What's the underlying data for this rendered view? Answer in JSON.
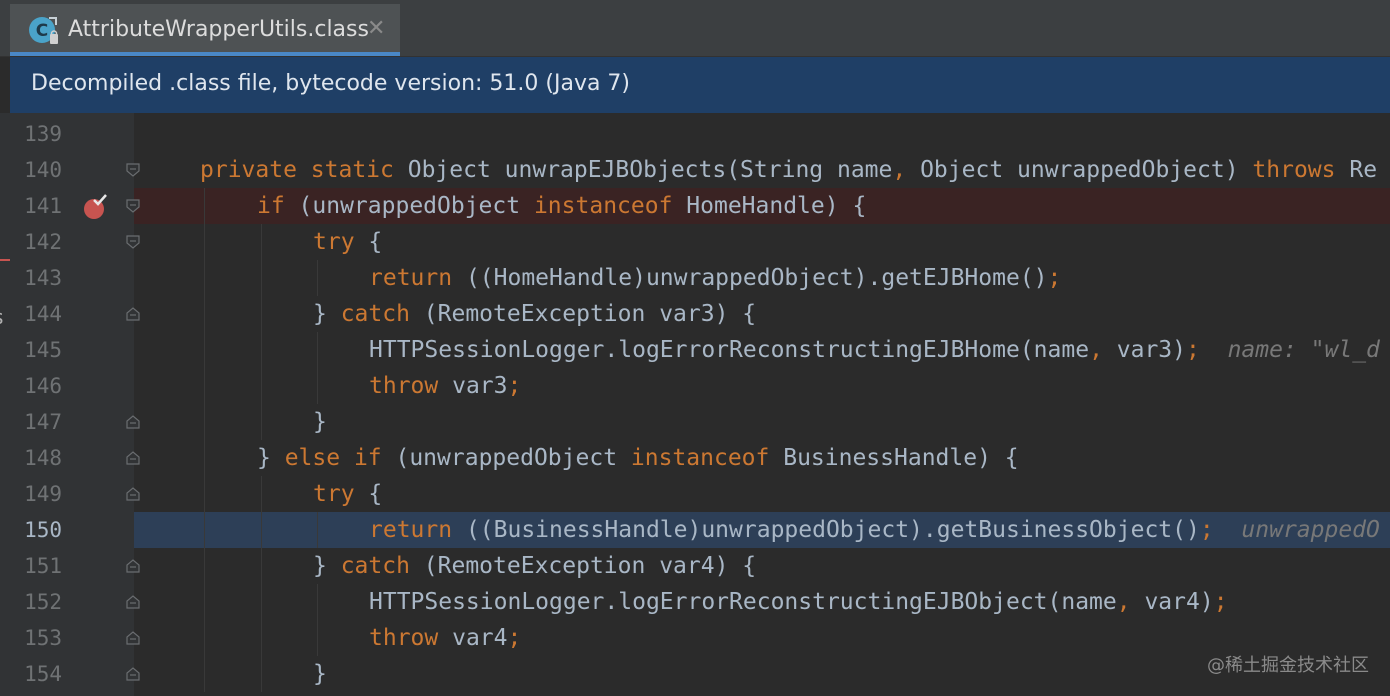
{
  "tab": {
    "title": "AttributeWrapperUtils.class",
    "close_glyph": "✕",
    "icon": "class-file-icon"
  },
  "banner": {
    "text": "Decompiled .class file, bytecode version: 51.0 (Java 7)"
  },
  "left_strip_letter": "s",
  "lines": [
    {
      "num": "139",
      "indent": 0,
      "tokens": []
    },
    {
      "num": "140",
      "indent": 1,
      "tokens": [
        {
          "t": "private ",
          "c": "kw"
        },
        {
          "t": "static ",
          "c": "kw"
        },
        {
          "t": "Object unwrapEJBObjects(String name",
          "c": ""
        },
        {
          "t": ", ",
          "c": "kw"
        },
        {
          "t": "Object unwrappedObject) ",
          "c": ""
        },
        {
          "t": "throws ",
          "c": "kw"
        },
        {
          "t": "Re",
          "c": ""
        }
      ]
    },
    {
      "num": "141",
      "indent": 2,
      "tokens": [
        {
          "t": "if ",
          "c": "kw"
        },
        {
          "t": "(unwrappedObject ",
          "c": ""
        },
        {
          "t": "instanceof ",
          "c": "kw"
        },
        {
          "t": "HomeHandle) {",
          "c": ""
        }
      ]
    },
    {
      "num": "142",
      "indent": 3,
      "tokens": [
        {
          "t": "try ",
          "c": "kw"
        },
        {
          "t": "{",
          "c": ""
        }
      ]
    },
    {
      "num": "143",
      "indent": 4,
      "tokens": [
        {
          "t": "return ",
          "c": "kw"
        },
        {
          "t": "((HomeHandle)unwrappedObject).getEJBHome()",
          "c": ""
        },
        {
          "t": ";",
          "c": "kw"
        }
      ]
    },
    {
      "num": "144",
      "indent": 3,
      "tokens": [
        {
          "t": "} ",
          "c": ""
        },
        {
          "t": "catch ",
          "c": "kw"
        },
        {
          "t": "(RemoteException var3) {",
          "c": ""
        }
      ]
    },
    {
      "num": "145",
      "indent": 4,
      "tokens": [
        {
          "t": "HTTPSessionLogger.logErrorReconstructingEJBHome(name",
          "c": ""
        },
        {
          "t": ", ",
          "c": "kw"
        },
        {
          "t": "var3)",
          "c": ""
        },
        {
          "t": ";",
          "c": "kw"
        },
        {
          "t": "  name: ",
          "c": "hint"
        },
        {
          "t": "\"wl_d",
          "c": "hint-str"
        }
      ]
    },
    {
      "num": "146",
      "indent": 4,
      "tokens": [
        {
          "t": "throw ",
          "c": "kw"
        },
        {
          "t": "var3",
          "c": ""
        },
        {
          "t": ";",
          "c": "kw"
        }
      ]
    },
    {
      "num": "147",
      "indent": 3,
      "tokens": [
        {
          "t": "}",
          "c": ""
        }
      ]
    },
    {
      "num": "148",
      "indent": 2,
      "tokens": [
        {
          "t": "} ",
          "c": ""
        },
        {
          "t": "else if ",
          "c": "kw"
        },
        {
          "t": "(unwrappedObject ",
          "c": ""
        },
        {
          "t": "instanceof ",
          "c": "kw"
        },
        {
          "t": "BusinessHandle) {",
          "c": ""
        }
      ]
    },
    {
      "num": "149",
      "indent": 3,
      "tokens": [
        {
          "t": "try ",
          "c": "kw"
        },
        {
          "t": "{",
          "c": ""
        }
      ]
    },
    {
      "num": "150",
      "indent": 4,
      "tokens": [
        {
          "t": "return ",
          "c": "kw"
        },
        {
          "t": "((BusinessHandle)unwrappedObject).getBusinessObject()",
          "c": ""
        },
        {
          "t": ";",
          "c": "kw"
        },
        {
          "t": "  unwrappedO",
          "c": "hint"
        }
      ]
    },
    {
      "num": "151",
      "indent": 3,
      "tokens": [
        {
          "t": "} ",
          "c": ""
        },
        {
          "t": "catch ",
          "c": "kw"
        },
        {
          "t": "(RemoteException var4) {",
          "c": ""
        }
      ]
    },
    {
      "num": "152",
      "indent": 4,
      "tokens": [
        {
          "t": "HTTPSessionLogger.logErrorReconstructingEJBObject(name",
          "c": ""
        },
        {
          "t": ", ",
          "c": "kw"
        },
        {
          "t": "var4)",
          "c": ""
        },
        {
          "t": ";",
          "c": "kw"
        }
      ]
    },
    {
      "num": "153",
      "indent": 4,
      "tokens": [
        {
          "t": "throw ",
          "c": "kw"
        },
        {
          "t": "var4",
          "c": ""
        },
        {
          "t": ";",
          "c": "kw"
        }
      ]
    },
    {
      "num": "154",
      "indent": 3,
      "tokens": [
        {
          "t": "}",
          "c": ""
        }
      ]
    }
  ],
  "breakpoint_line": "141",
  "current_line": "150",
  "fold_markers": {
    "140": "open",
    "141": "open",
    "142": "open",
    "144": "close",
    "147": "close",
    "148": "close",
    "149": "close",
    "151": "close",
    "152": "close",
    "153": "close",
    "154": "close"
  },
  "colors": {
    "keyword": "#cc7832",
    "text": "#a9b7c6",
    "breakpoint_row": "#3a2323",
    "current_row": "#2d3f57",
    "breakpoint_dot": "#c75450",
    "banner": "#1f3f66"
  },
  "watermark": "@稀土掘金技术社区"
}
